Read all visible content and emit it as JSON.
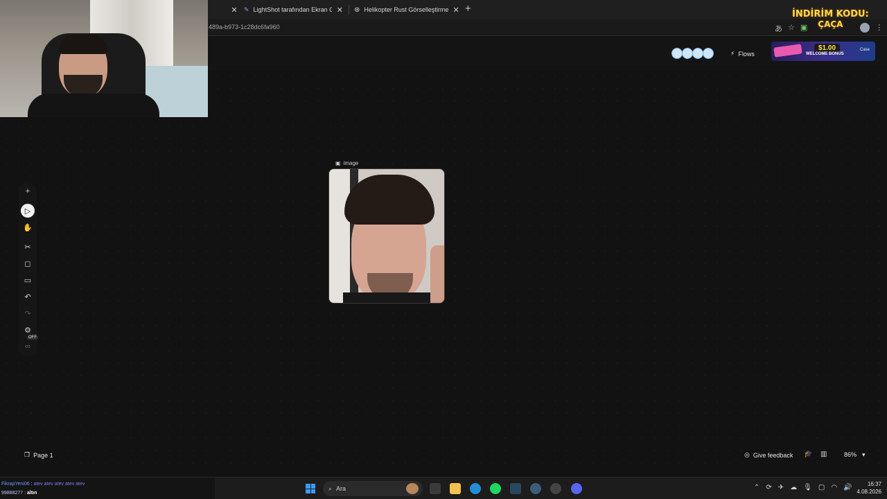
{
  "browser": {
    "tabs": [
      {
        "title": "LightShot tarafından Ekran Görünt"
      },
      {
        "title": "Helikopter Rust Görselleştirme"
      }
    ],
    "url": "489a-b973-1c28dc6fa960"
  },
  "header": {
    "flows_label": "Flows"
  },
  "promo": {
    "code_title": "İNDİRİM KODU:",
    "code_value": "ÇAÇA",
    "banner_amount": "$1.00",
    "banner_bonus": "WELCOME BONUS",
    "banner_brand": "Case"
  },
  "canvas": {
    "node_label": "image",
    "toolbar_off_badge": "OFF"
  },
  "footer": {
    "page_label": "Page 1",
    "feedback_label": "Give feedback",
    "zoom_level": "86%"
  },
  "chat": {
    "line1_user": "FikrapYeni06",
    "line1_message": "atev atev atev atev atev",
    "line2_user": "99888277",
    "line2_message": "altın"
  },
  "taskbar": {
    "search_placeholder": "Ara",
    "time": "16:37",
    "date": "4.08.2026"
  }
}
